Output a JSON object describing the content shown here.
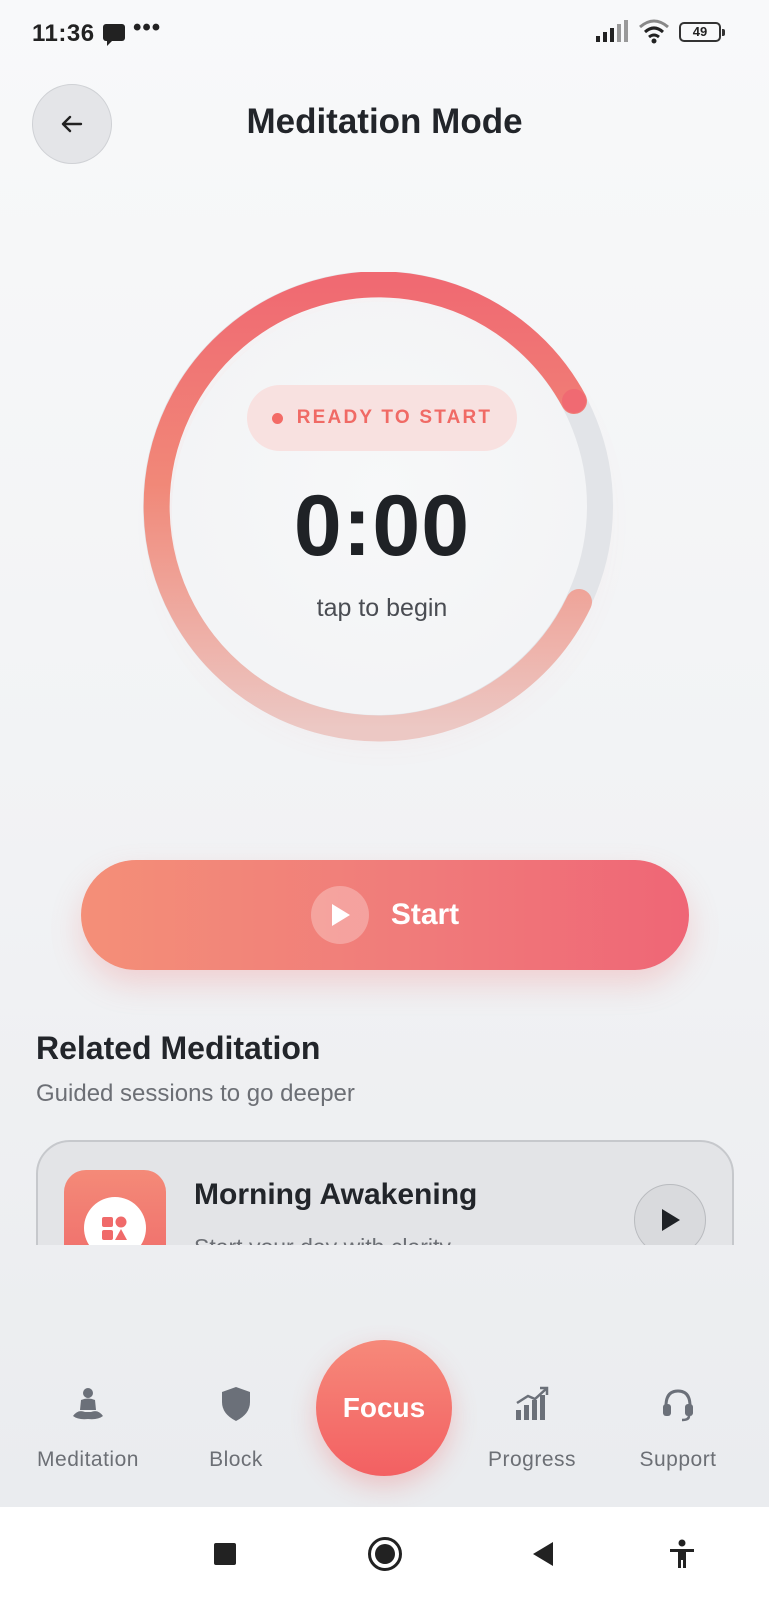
{
  "status_bar": {
    "time": "11:36",
    "battery": "49",
    "icons": [
      "message-icon",
      "more-dots-icon",
      "signal-icon",
      "wifi-icon",
      "battery-icon"
    ]
  },
  "header": {
    "title": "Meditation Mode",
    "back_icon": "arrow-left-icon"
  },
  "timer": {
    "status_label": "READY TO START",
    "time": "0:00",
    "hint": "tap to begin",
    "colors": {
      "accent": "#f36b66",
      "track": "#e2e4e8"
    }
  },
  "start_button": {
    "label": "Start",
    "icon": "play-icon"
  },
  "related": {
    "title": "Related Meditation",
    "subtitle": "Guided sessions to go deeper",
    "items": [
      {
        "title": "Morning Awakening",
        "description": "Start your day with clarity",
        "icon": "shapes-icon",
        "action_icon": "play-icon"
      }
    ]
  },
  "bottom_nav": {
    "items": [
      {
        "label": "Meditation",
        "icon": "meditation-person-icon"
      },
      {
        "label": "Block",
        "icon": "shield-icon"
      },
      {
        "label": "Focus",
        "icon": ""
      },
      {
        "label": "Progress",
        "icon": "chart-up-icon"
      },
      {
        "label": "Support",
        "icon": "headset-icon"
      }
    ],
    "active": "Focus"
  },
  "system_nav": {
    "icons": [
      "recents-square-icon",
      "home-circle-icon",
      "back-triangle-icon",
      "accessibility-icon"
    ]
  }
}
